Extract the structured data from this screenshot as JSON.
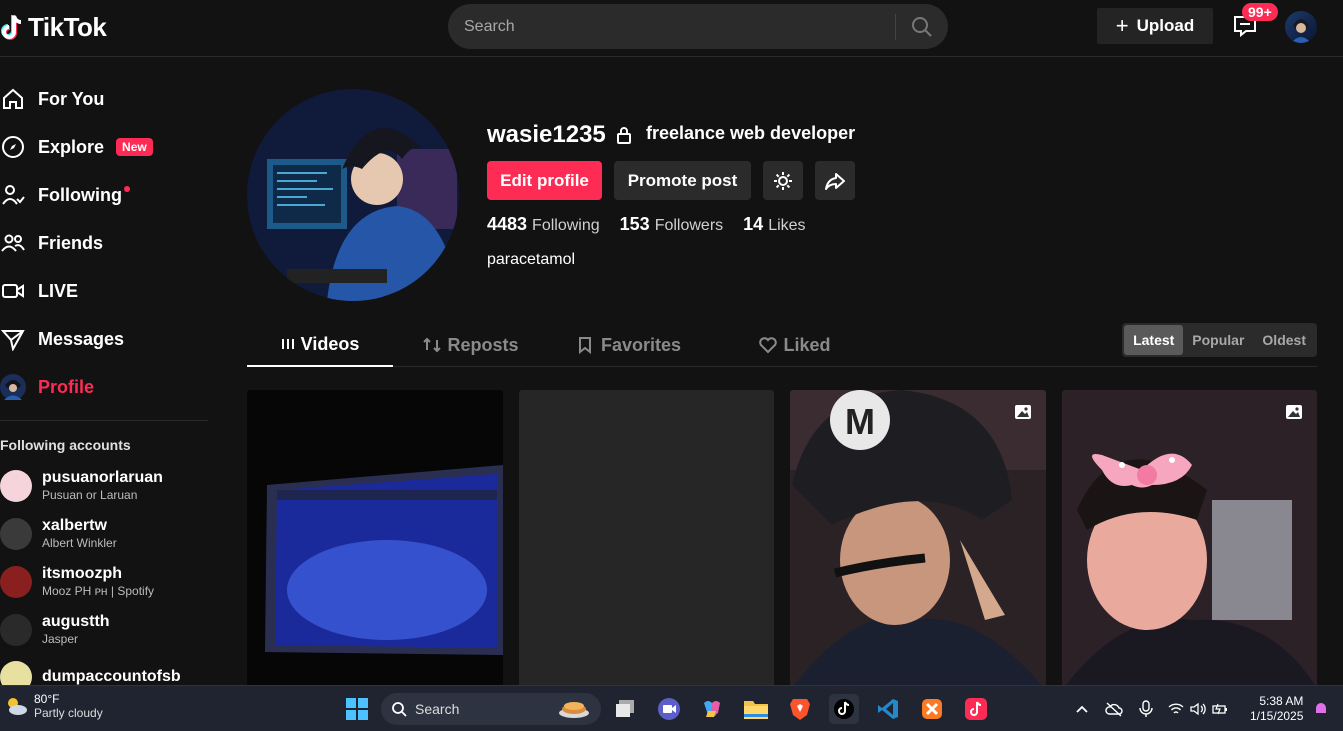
{
  "header": {
    "logo_text": "TikTok",
    "search_placeholder": "Search",
    "upload_label": "Upload",
    "inbox_badge": "99+"
  },
  "sidebar": {
    "items": [
      {
        "label": "For You",
        "icon": "home-icon"
      },
      {
        "label": "Explore",
        "icon": "compass-icon",
        "badge": "New"
      },
      {
        "label": "Following",
        "icon": "following-icon"
      },
      {
        "label": "Friends",
        "icon": "friends-icon"
      },
      {
        "label": "LIVE",
        "icon": "live-icon"
      },
      {
        "label": "Messages",
        "icon": "send-icon"
      },
      {
        "label": "Profile",
        "icon": "avatar"
      }
    ],
    "following_heading": "Following accounts",
    "accounts": [
      {
        "username": "pusuanorlaruan",
        "name": "Pusuan or Laruan"
      },
      {
        "username": "xalbertw",
        "name": "Albert Winkler"
      },
      {
        "username": "itsmoozph",
        "name": "Mooz PH ᴘʜ | Spotify"
      },
      {
        "username": "augustth",
        "name": "Jasper"
      },
      {
        "username": "dumpaccountofsb",
        "name": ""
      }
    ]
  },
  "profile": {
    "username": "wasie1235",
    "display_name": "freelance web developer",
    "edit_label": "Edit profile",
    "promote_label": "Promote post",
    "stats": [
      {
        "num": "4483",
        "label": "Following"
      },
      {
        "num": "153",
        "label": "Followers"
      },
      {
        "num": "14",
        "label": "Likes"
      }
    ],
    "bio": "paracetamol"
  },
  "tabs": [
    "Videos",
    "Reposts",
    "Favorites",
    "Liked"
  ],
  "sort": [
    "Latest",
    "Popular",
    "Oldest"
  ],
  "taskbar": {
    "temp": "80°F",
    "weather": "Partly cloudy",
    "search": "Search",
    "time": "5:38 AM",
    "date": "1/15/2025"
  },
  "colors": {
    "accent": "#fe2c55",
    "bg": "#121212"
  }
}
